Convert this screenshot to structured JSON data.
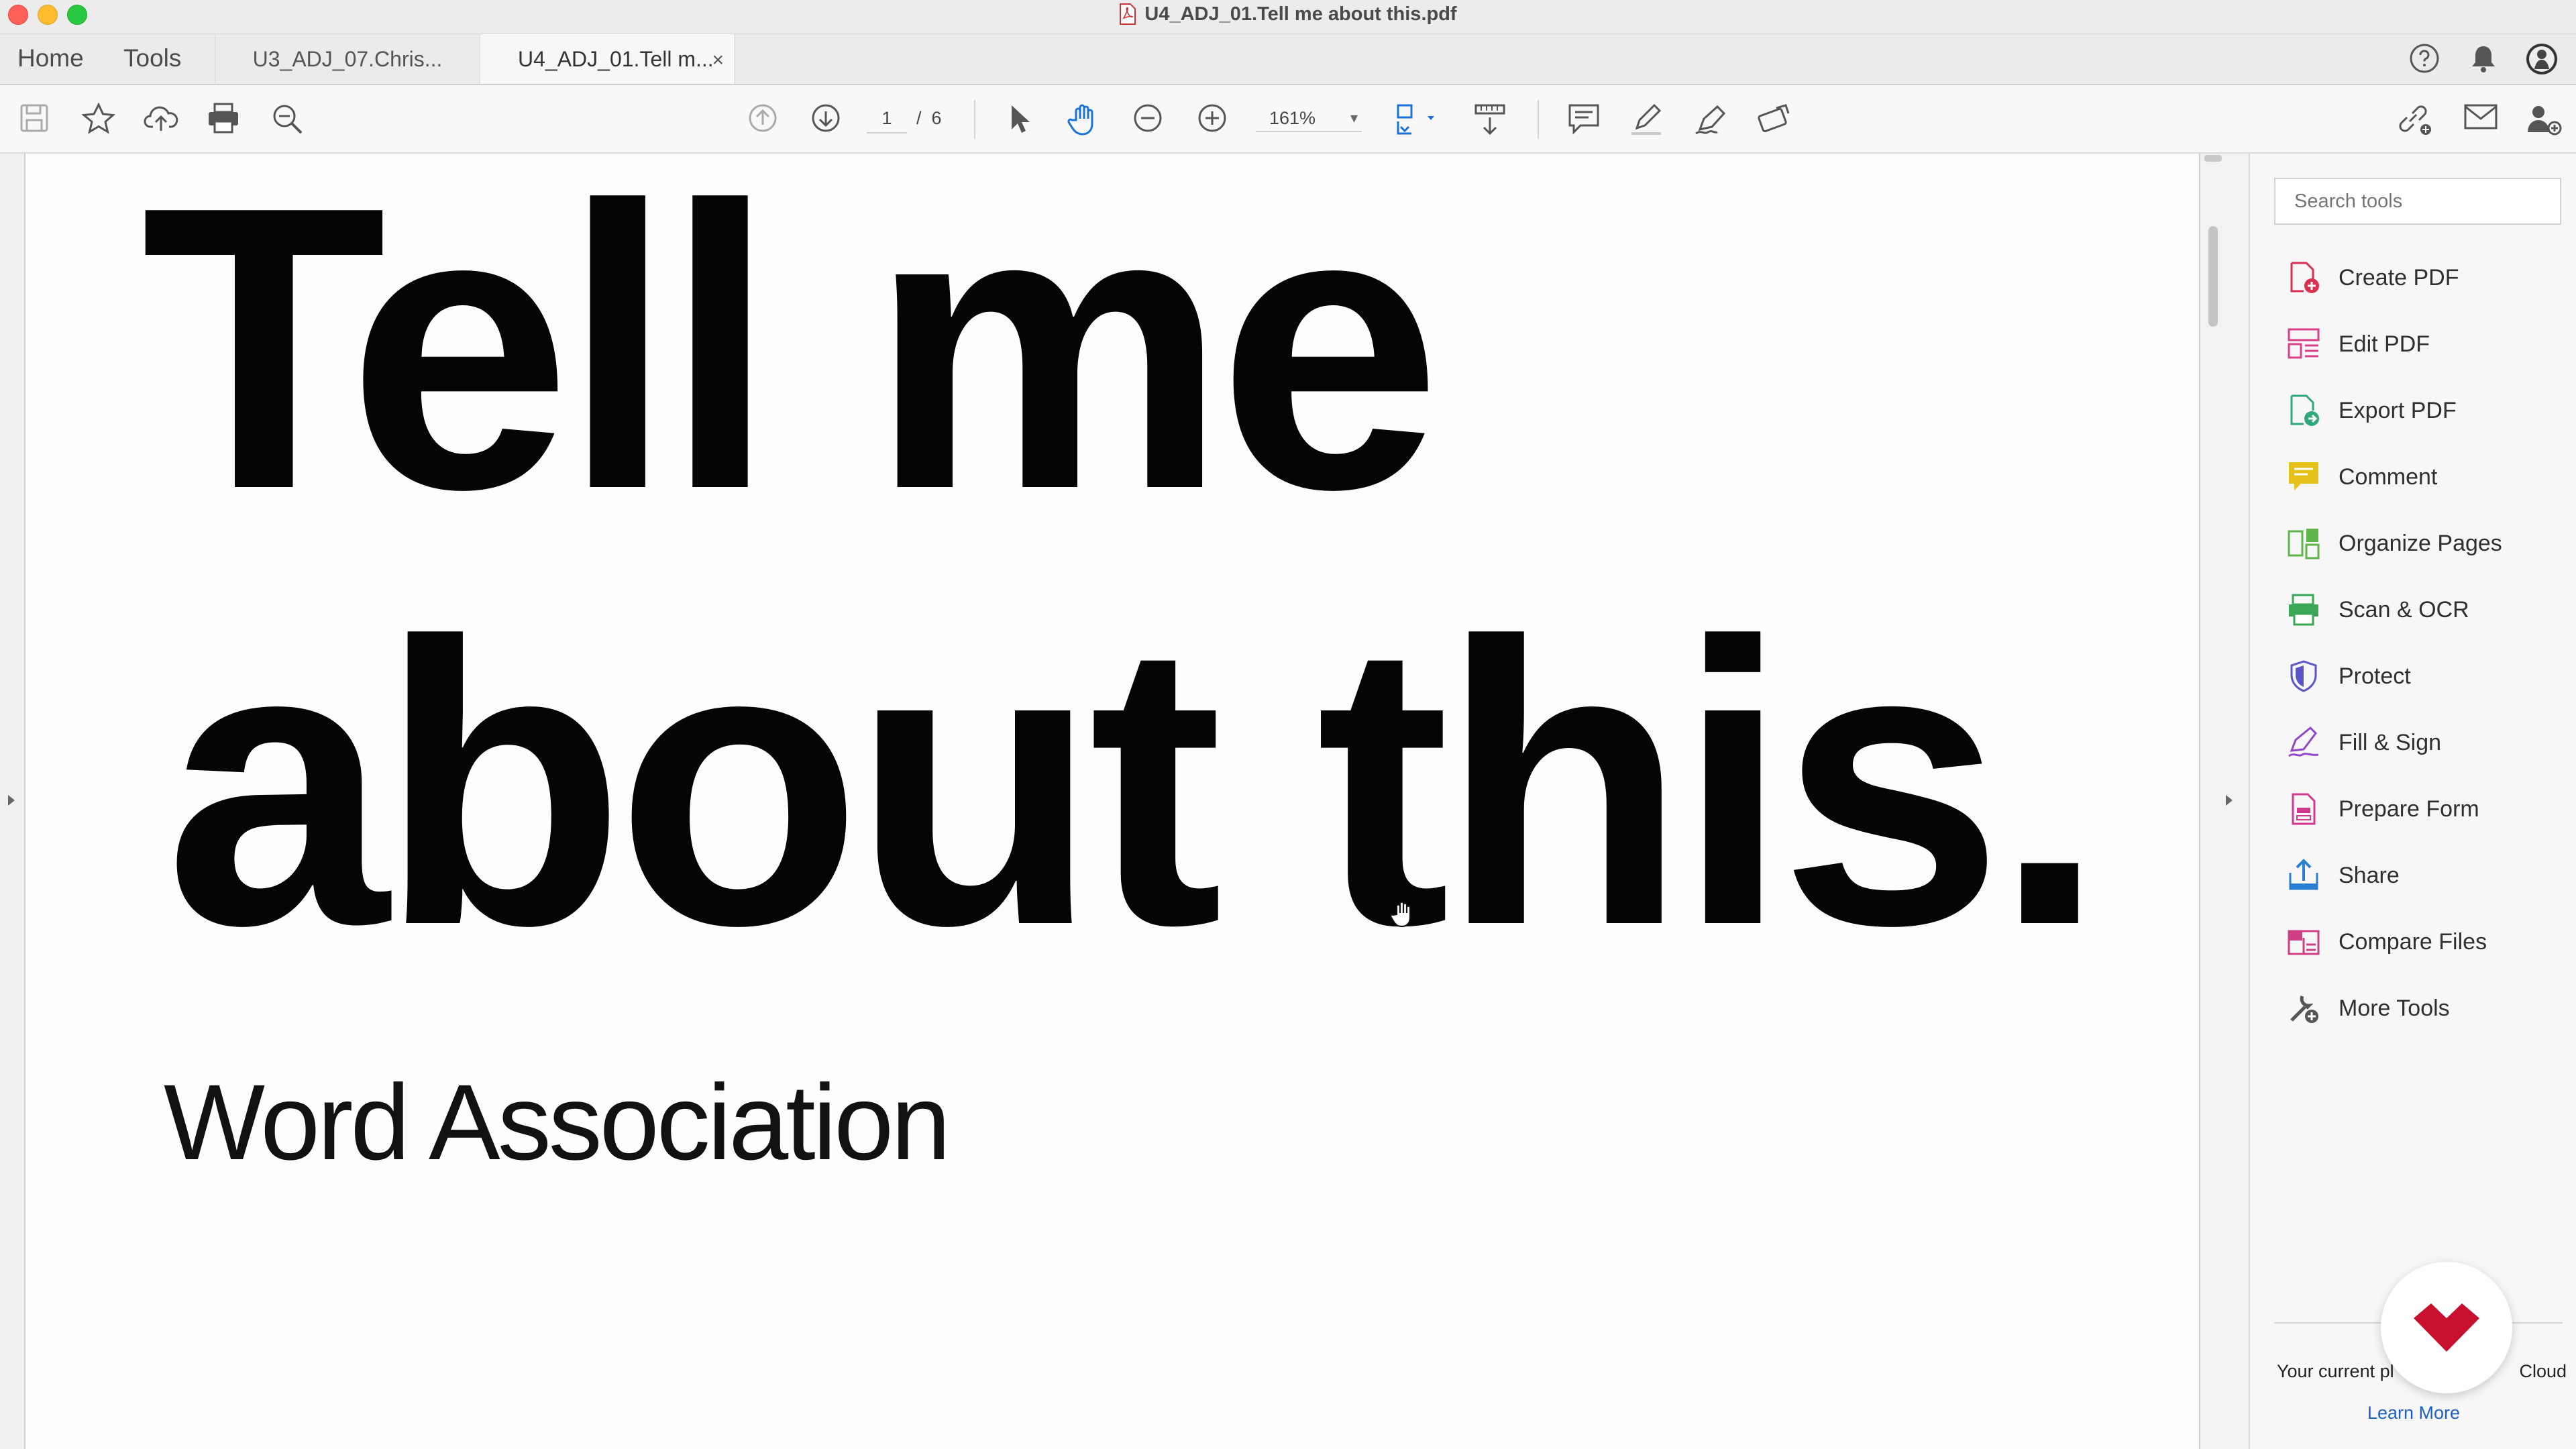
{
  "window": {
    "title": "U4_ADJ_01.Tell me about this.pdf"
  },
  "menu": {
    "home": "Home",
    "tools": "Tools"
  },
  "tabs": [
    {
      "label": "U3_ADJ_07.Chris..."
    },
    {
      "label": "U4_ADJ_01.Tell m...",
      "close": "×"
    }
  ],
  "toolbar": {
    "page_current": "1",
    "page_separator": "/",
    "page_total": "6",
    "zoom": "161%"
  },
  "document": {
    "heading_line1": "Tell me",
    "heading_line2": "about this.",
    "subtitle": "Word Association"
  },
  "tools_pane": {
    "search_placeholder": "Search tools",
    "items": [
      {
        "label": "Create PDF",
        "icon": "create-pdf-icon",
        "color": "#d9304f"
      },
      {
        "label": "Edit PDF",
        "icon": "edit-pdf-icon",
        "color": "#d8408c"
      },
      {
        "label": "Export PDF",
        "icon": "export-pdf-icon",
        "color": "#2fa77b"
      },
      {
        "label": "Comment",
        "icon": "comment-icon",
        "color": "#e7c21c"
      },
      {
        "label": "Organize Pages",
        "icon": "organize-pages-icon",
        "color": "#5fb54a"
      },
      {
        "label": "Scan & OCR",
        "icon": "scan-ocr-icon",
        "color": "#3aa656"
      },
      {
        "label": "Protect",
        "icon": "protect-icon",
        "color": "#5b56c7"
      },
      {
        "label": "Fill & Sign",
        "icon": "fill-sign-icon",
        "color": "#9046c8"
      },
      {
        "label": "Prepare Form",
        "icon": "prepare-form-icon",
        "color": "#d2388e"
      },
      {
        "label": "Share",
        "icon": "share-icon",
        "color": "#2a7fd2"
      },
      {
        "label": "Compare Files",
        "icon": "compare-files-icon",
        "color": "#cf3f86"
      },
      {
        "label": "More Tools",
        "icon": "more-tools-icon",
        "color": "#555555"
      }
    ],
    "plan_text_left": "Your current pl",
    "plan_text_right": "Cloud",
    "learn_more": "Learn More"
  },
  "colors": {
    "promo_red": "#c8102e"
  }
}
